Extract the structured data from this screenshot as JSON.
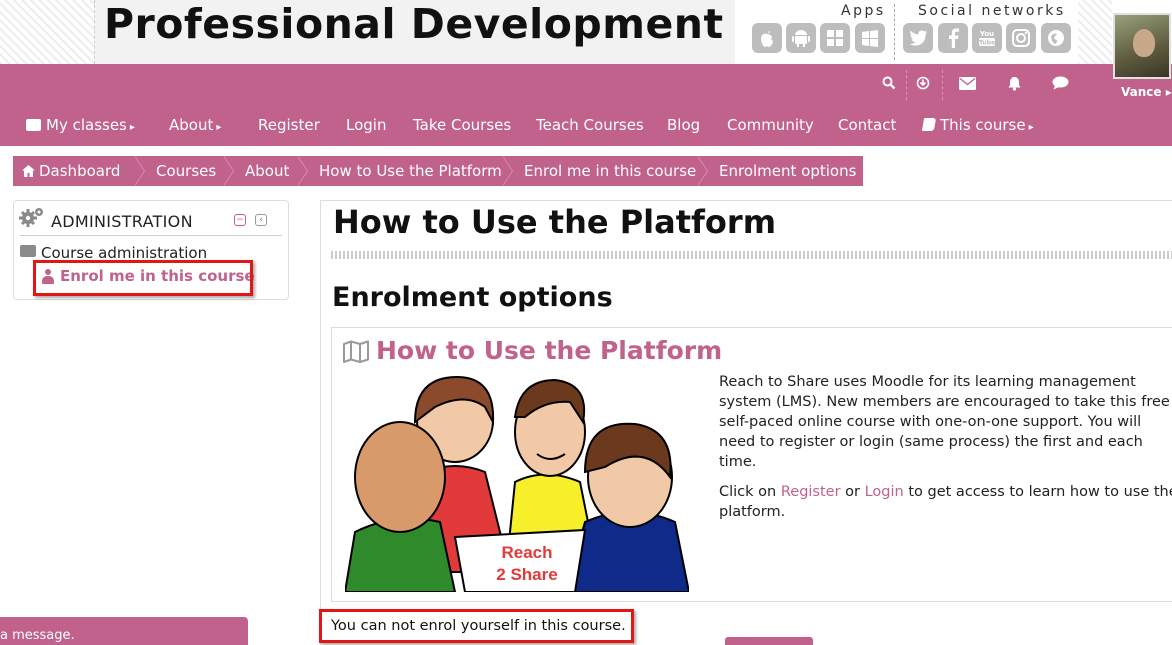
{
  "header": {
    "site_title": "Professional Development",
    "apps_label": "Apps",
    "social_label": "Social networks",
    "app_icons": [
      "apple-icon",
      "android-icon",
      "windows-icon",
      "windows-store-icon"
    ],
    "social_icons": [
      "twitter-icon",
      "facebook-icon",
      "youtube-icon",
      "instagram-icon",
      "web-icon"
    ],
    "user_name": "Vance ▸"
  },
  "utility_icons": [
    "search-icon",
    "download-icon",
    "mail-icon",
    "bell-icon",
    "chat-icon"
  ],
  "menu": {
    "items": [
      {
        "label": "My classes",
        "icon": "briefcase-icon",
        "caret": "▸"
      },
      {
        "label": "About",
        "caret": "▸"
      },
      {
        "label": "Register"
      },
      {
        "label": "Login"
      },
      {
        "label": "Take Courses"
      },
      {
        "label": "Teach Courses"
      },
      {
        "label": "Blog"
      },
      {
        "label": "Community"
      },
      {
        "label": "Contact"
      },
      {
        "label": "This course",
        "icon": "book-icon",
        "caret": "▸"
      }
    ]
  },
  "breadcrumb": {
    "items": [
      "Dashboard",
      "Courses",
      "About",
      "How to Use the Platform",
      "Enrol me in this course",
      "Enrolment options"
    ]
  },
  "admin": {
    "title": "ADMINISTRATION",
    "collapse": "−",
    "dock": "‹",
    "course_admin": "Course administration",
    "enrol_link": "Enrol me in this course"
  },
  "main": {
    "page_title": "How to Use the Platform",
    "section_title": "Enrolment options",
    "course_name": "How to Use the Platform",
    "summary_p1": "Reach to Share uses Moodle for its learning management system (LMS). New members are encouraged to take this free self-paced online course with one-on-one support. You will need to register or login (same process) the first and each time.",
    "summary_p2_a": "Click on ",
    "summary_p2_register": "Register",
    "summary_p2_or": " or ",
    "summary_p2_login": "Login",
    "summary_p2_b": " to get access to learn how to use the platform.",
    "image_sign": [
      "Reach",
      "2 Share"
    ],
    "notice": "You can not enrol yourself in this course."
  },
  "messaging": {
    "text": "a message."
  },
  "colors": {
    "brand_pink": "#c0628c",
    "highlight_red": "#e31616"
  }
}
